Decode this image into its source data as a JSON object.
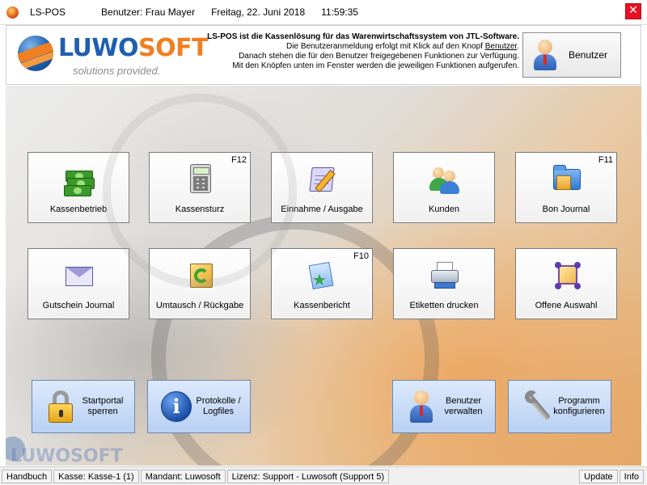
{
  "titlebar": {
    "app_title": "LS-POS",
    "user": "Benutzer: Frau Mayer",
    "date": "Freitag, 22. Juni 2018",
    "time": "11:59:35",
    "close_label": "✕"
  },
  "header": {
    "logo": {
      "word_a": "LUWO",
      "word_b": "SOFT",
      "tagline": "solutions provided."
    },
    "info_line1": "LS-POS ist die Kassenlösung für das Warenwirtschaftssystem von JTL-Software.",
    "info_line2_pre": "Die Benutzeranmeldung erfolgt mit Klick auf den Knopf ",
    "info_line2_link": "Benutzer",
    "info_line2_post": ".",
    "info_line3": "Danach stehen die für den Benutzer freigegebenen Funktionen zur Verfügung.",
    "info_line4": "Mit den Knöpfen unten im Fenster werden die jeweiligen Funktionen aufgerufen.",
    "user_button": "Benutzer"
  },
  "tiles_row1": [
    {
      "label": "Kassenbetrieb",
      "key": ""
    },
    {
      "label": "Kassensturz",
      "key": "F12"
    },
    {
      "label": "Einnahme / Ausgabe",
      "key": ""
    },
    {
      "label": "Kunden",
      "key": ""
    },
    {
      "label": "Bon Journal",
      "key": "F11"
    }
  ],
  "tiles_row2": [
    {
      "label": "Gutschein Journal",
      "key": ""
    },
    {
      "label": "Umtausch / Rückgabe",
      "key": ""
    },
    {
      "label": "Kassenbericht",
      "key": "F10"
    },
    {
      "label": "Etiketten drucken",
      "key": ""
    },
    {
      "label": "Offene Auswahl",
      "key": ""
    }
  ],
  "bottom_buttons": [
    {
      "line1": "Startportal",
      "line2": "sperren"
    },
    {
      "line1": "Protokolle /",
      "line2": "Logfiles"
    },
    {
      "line1": "Benutzer",
      "line2": "verwalten"
    },
    {
      "line1": "Programm",
      "line2": "konfigurieren"
    }
  ],
  "watermark": "LUWOSOFT",
  "statusbar": {
    "handbuch": "Handbuch",
    "kasse": "Kasse: Kasse-1 (1)",
    "mandant": "Mandant: Luwosoft",
    "lizenz": "Lizenz: Support - Luwosoft (Support 5)",
    "update": "Update",
    "info": "Info"
  },
  "colors": {
    "tile_border": "#7a7a7a",
    "bottom_button_bg": "#c7dbf6",
    "close_red": "#e81123",
    "logo_blue": "#1f5fb0",
    "logo_orange": "#f07f22"
  }
}
